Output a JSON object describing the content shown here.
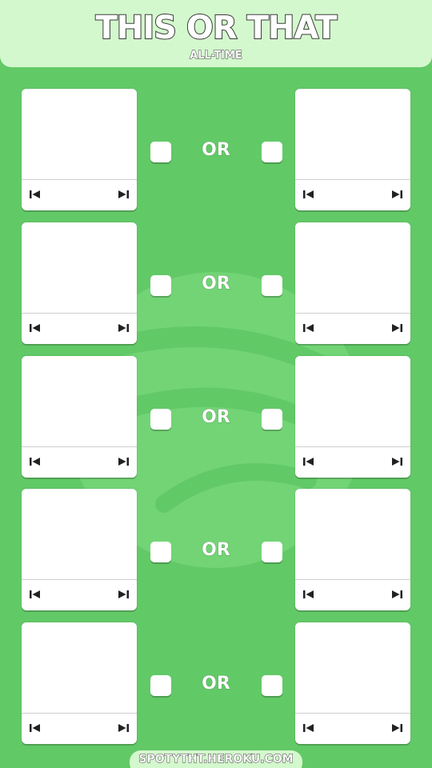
{
  "header": {
    "title": "THIS OR THAT",
    "subtitle": "ALL-TIME"
  },
  "colors": {
    "background": "#62c967",
    "header_bg": "#d4f8cd",
    "logo_tint": "#78d87a",
    "card": "#ffffff",
    "text_outline": "#3a3a3a"
  },
  "icons": {
    "previous": "skip-previous-icon",
    "next": "skip-next-icon",
    "background_logo": "spotify-logo-watermark"
  },
  "rows": [
    {
      "or_label": "OR"
    },
    {
      "or_label": "OR"
    },
    {
      "or_label": "OR"
    },
    {
      "or_label": "OR"
    },
    {
      "or_label": "OR"
    }
  ],
  "footer": {
    "url": "SPOTYTHT.HEROKU.COM"
  }
}
